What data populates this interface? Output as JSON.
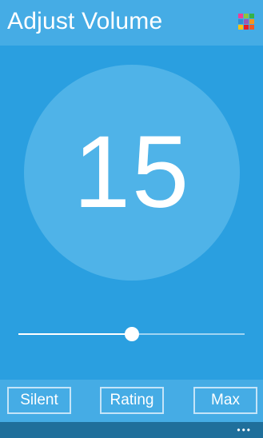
{
  "header": {
    "title": "Adjust Volume",
    "app_icon": {
      "name": "colorful-grid-icon",
      "colors": [
        "#ef3e96",
        "#8bc63f",
        "#34b34a",
        "#2d8fd5",
        "#9b59b6",
        "#f7941d",
        "#ffc20e",
        "#ed1c24",
        "#f15a24"
      ]
    }
  },
  "volume": {
    "value": "15",
    "slider_fraction": 0.5
  },
  "buttons": {
    "silent": "Silent",
    "rating": "Rating",
    "max": "Max"
  },
  "appbar": {
    "more": "•••"
  },
  "colors": {
    "background": "#2a9fe0",
    "header": "#45ace5",
    "circle": "#4fb3e8",
    "appbar": "#1f6f9b"
  }
}
